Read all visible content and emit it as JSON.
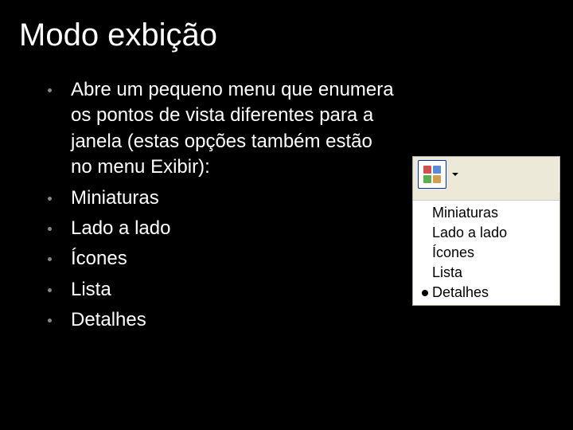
{
  "title": "Modo exbição",
  "bullets": [
    "Abre um pequeno menu que enumera os pontos de vista diferentes para a janela (estas opções também estão no menu Exibir):",
    "Miniaturas",
    "Lado a lado",
    "Ícones",
    "Lista",
    "Detalhes"
  ],
  "menu": {
    "items": [
      {
        "label": "Miniaturas",
        "selected": false
      },
      {
        "label": "Lado a lado",
        "selected": false
      },
      {
        "label": "Ícones",
        "selected": false
      },
      {
        "label": "Lista",
        "selected": false
      },
      {
        "label": "Detalhes",
        "selected": true
      }
    ]
  }
}
